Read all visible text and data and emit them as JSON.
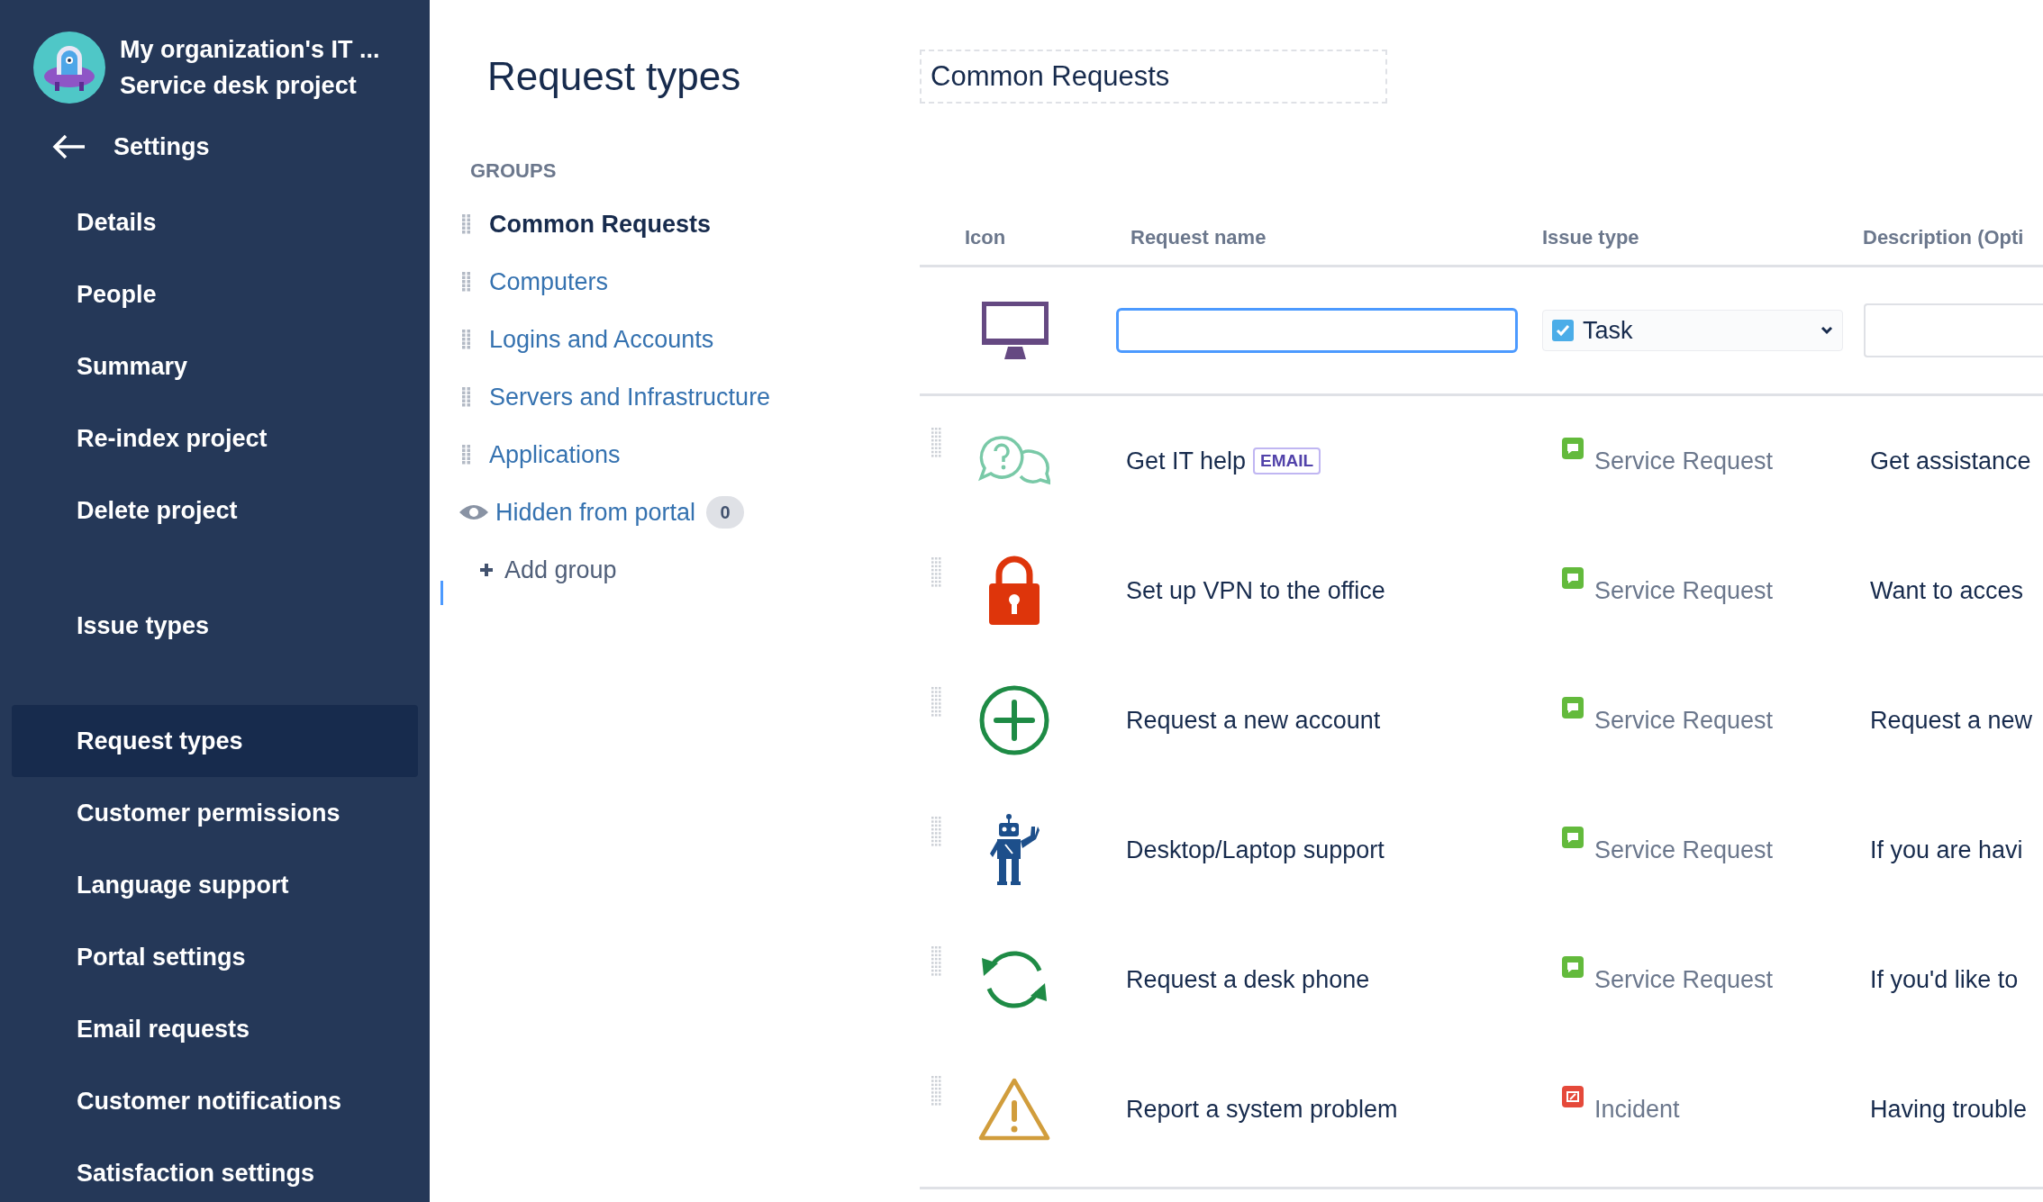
{
  "sidebar": {
    "project": {
      "title": "My organization's IT ...",
      "subtitle": "Service desk project"
    },
    "back": {
      "label": "Settings"
    },
    "sections": [
      [
        {
          "label": "Details",
          "selected": false
        },
        {
          "label": "People",
          "selected": false
        },
        {
          "label": "Summary",
          "selected": false
        },
        {
          "label": "Re-index project",
          "selected": false
        },
        {
          "label": "Delete project",
          "selected": false
        }
      ],
      [
        {
          "label": "Issue types",
          "selected": false
        }
      ],
      [
        {
          "label": "Request types",
          "selected": true
        },
        {
          "label": "Customer permissions",
          "selected": false
        },
        {
          "label": "Language support",
          "selected": false
        },
        {
          "label": "Portal settings",
          "selected": false
        },
        {
          "label": "Email requests",
          "selected": false
        },
        {
          "label": "Customer notifications",
          "selected": false
        },
        {
          "label": "Satisfaction settings",
          "selected": false
        }
      ]
    ]
  },
  "page": {
    "title": "Request types",
    "group_name": "Common Requests"
  },
  "groups": {
    "heading": "GROUPS",
    "items": [
      {
        "kind": "group",
        "label": "Common Requests",
        "selected": true
      },
      {
        "kind": "group",
        "label": "Computers",
        "selected": false
      },
      {
        "kind": "group",
        "label": "Logins and Accounts",
        "selected": false
      },
      {
        "kind": "group",
        "label": "Servers and Infrastructure",
        "selected": false
      },
      {
        "kind": "group",
        "label": "Applications",
        "selected": false
      },
      {
        "kind": "hidden",
        "label": "Hidden from portal",
        "selected": false,
        "count": "0"
      }
    ],
    "add": "Add group"
  },
  "table": {
    "columns": [
      "Icon",
      "Request name",
      "Issue type",
      "Description (Opti"
    ],
    "new_row": {
      "issue_type": "Task"
    },
    "rows": [
      {
        "name": "Get IT help",
        "badge": "EMAIL",
        "issue_type": {
          "kind": "service_request",
          "label": "Service Request"
        },
        "description": "Get assistance"
      },
      {
        "name": "Set up VPN to the office",
        "issue_type": {
          "kind": "service_request",
          "label": "Service Request"
        },
        "description": "Want to acces"
      },
      {
        "name": "Request a new account",
        "issue_type": {
          "kind": "service_request",
          "label": "Service Request"
        },
        "description": "Request a new"
      },
      {
        "name": "Desktop/Laptop support",
        "issue_type": {
          "kind": "service_request",
          "label": "Service Request"
        },
        "description": "If you are havi"
      },
      {
        "name": "Request a desk phone",
        "issue_type": {
          "kind": "service_request",
          "label": "Service Request"
        },
        "description": "If you'd like to"
      },
      {
        "name": "Report a system problem",
        "issue_type": {
          "kind": "incident",
          "label": "Incident"
        },
        "description": "Having trouble"
      }
    ]
  }
}
